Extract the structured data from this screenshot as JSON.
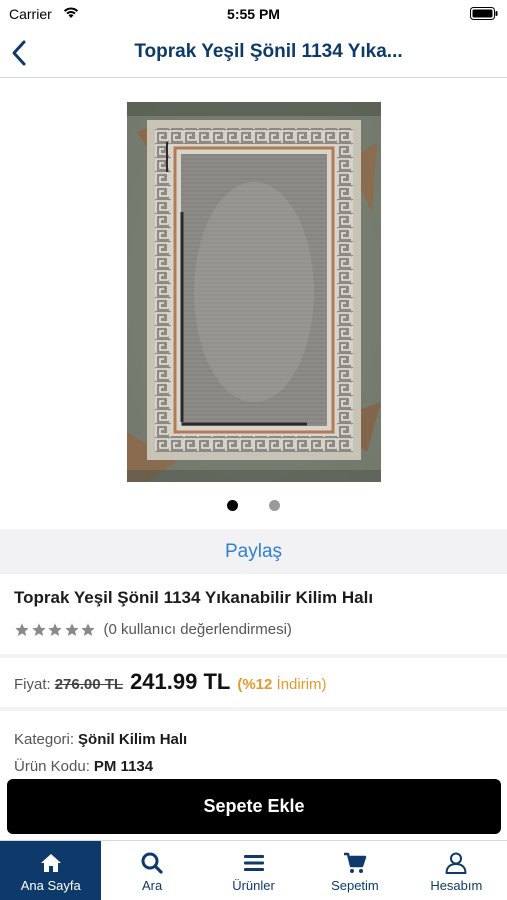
{
  "status_bar": {
    "carrier": "Carrier",
    "time": "5:55 PM"
  },
  "nav": {
    "title": "Toprak Yeşil Şönil 1134 Yıka..."
  },
  "gallery": {
    "page_count": 2,
    "current_page": 1
  },
  "share": {
    "label": "Paylaş"
  },
  "product": {
    "title": "Toprak Yeşil Şönil 1134 Yıkanabilir Kilim Halı",
    "rating_stars": 5,
    "rating_text": "(0 kullanıcı değerlendirmesi)",
    "price_label": "Fiyat:",
    "old_price": "276.00 TL",
    "new_price": "241.99 TL",
    "discount_percent": "(%12",
    "discount_word": "İndirim)",
    "category_label": "Kategori:",
    "category_value": "Şönil Kilim Halı",
    "code_label": "Ürün Kodu:",
    "code_value": "PM 1134"
  },
  "actions": {
    "add_to_cart": "Sepete Ekle"
  },
  "tab_bar": {
    "items": [
      {
        "label": "Ana Sayfa",
        "icon": "home-icon",
        "active": true
      },
      {
        "label": "Ara",
        "icon": "search-icon",
        "active": false
      },
      {
        "label": "Ürünler",
        "icon": "menu-icon",
        "active": false
      },
      {
        "label": "Sepetim",
        "icon": "cart-icon",
        "active": false
      },
      {
        "label": "Hesabım",
        "icon": "user-icon",
        "active": false
      }
    ]
  },
  "colors": {
    "brand_navy": "#0e3a6b",
    "link_blue": "#2f7fd7",
    "discount_orange": "#e39a2a",
    "button_black": "#000000"
  }
}
